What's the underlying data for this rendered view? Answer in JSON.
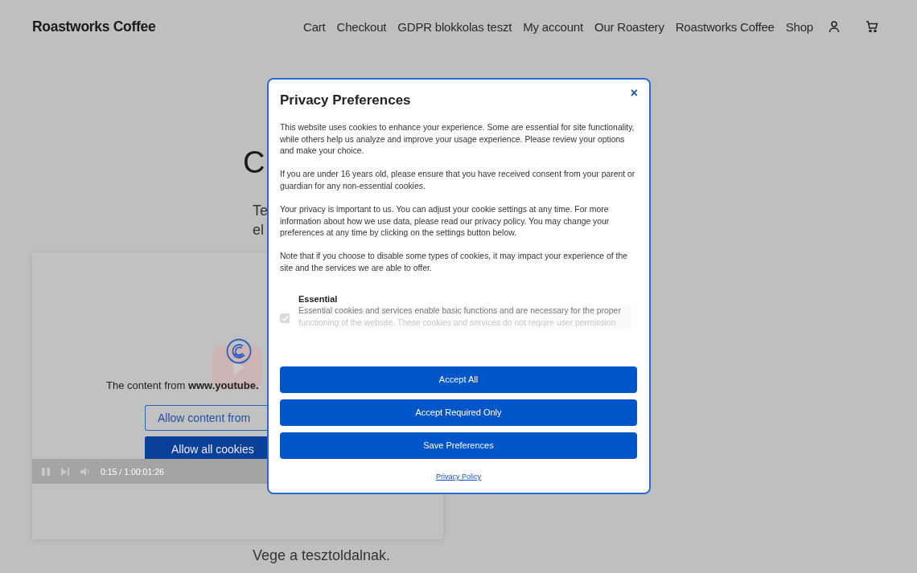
{
  "header": {
    "logo": "Roastworks Coffee",
    "nav": [
      {
        "label": "Cart"
      },
      {
        "label": "Checkout"
      },
      {
        "label": "GDPR blokkolas teszt"
      },
      {
        "label": "My account"
      },
      {
        "label": "Our Roastery"
      },
      {
        "label": "Roastworks Coffee"
      },
      {
        "label": "Shop"
      }
    ]
  },
  "page": {
    "heading": "C",
    "intro_lines": [
      "Te",
      "el"
    ],
    "embed": {
      "notice": "The content from **www.youtube.**",
      "buttons": [
        {
          "label": "Allow content from",
          "kind": "outline"
        },
        {
          "label": "Allow all cookies",
          "kind": "filled"
        }
      ],
      "player": {
        "time": "0:15 / 1:00:01:26"
      }
    },
    "closing": "Vege a tesztoldalnak."
  },
  "modal": {
    "title": "Privacy Preferences",
    "close": "×",
    "paragraphs": [
      "This website uses cookies to enhance your experience. Some are essential for site functionality, while others help us analyze and improve your usage experience. Please review your options and make your choice.",
      "If you are under 16 years old, please ensure that you have received consent from your parent or guardian for any non-essential cookies.",
      "Your privacy is important to us. You can adjust your cookie settings at any time. For more information about how we use data, please read our privacy policy. You may change your preferences at any time by clicking on the settings button below.",
      "Note that if you choose to disable some types of cookies, it may impact your experience of the site and the services we are able to offer."
    ],
    "categories": [
      {
        "name": "Essential",
        "checked": true,
        "disabled": true,
        "description_lines": [
          "Essential cookies and services enable basic functions and are necessary for the proper",
          "functioning of the website. These cookies and services do not require user permission"
        ]
      }
    ],
    "buttons": [
      "Accept All",
      "Accept Required Only",
      "Save Preferences"
    ],
    "link": "Privacy Policy"
  }
}
